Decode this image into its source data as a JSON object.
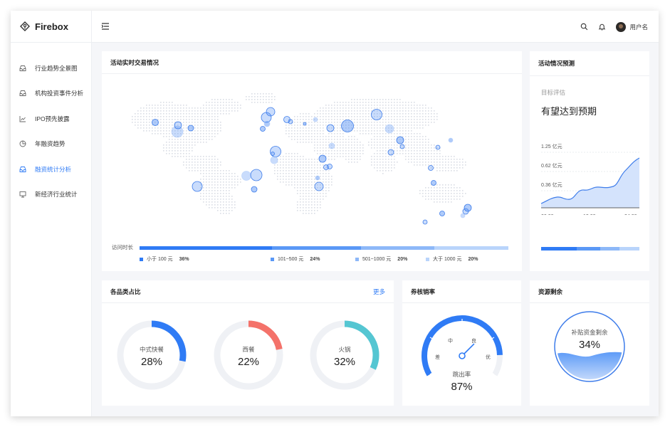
{
  "app": {
    "name": "Firebox"
  },
  "sidebar": {
    "items": [
      {
        "label": "行业趋势全景图",
        "icon": "inbox-icon",
        "active": false
      },
      {
        "label": "机构投资事件分析",
        "icon": "inbox-icon",
        "active": false
      },
      {
        "label": "IPO预先披露",
        "icon": "line-chart-icon",
        "active": false
      },
      {
        "label": "年融资趋势",
        "icon": "pie-chart-icon",
        "active": false
      },
      {
        "label": "融资统计分析",
        "icon": "inbox-icon",
        "active": true
      },
      {
        "label": "新经济行业统计",
        "icon": "monitor-icon",
        "active": false
      }
    ]
  },
  "header": {
    "username": "用户名",
    "icons": [
      "search-icon",
      "bell-icon"
    ]
  },
  "colors": {
    "accent": "#2f7bf5",
    "donut_1": "#2f7bf5",
    "donut_2": "#f4726a",
    "donut_3": "#55c6d2",
    "track": "#eff1f5"
  },
  "map_card": {
    "title": "活动实时交易情况",
    "legend_label": "访问时长",
    "legend": [
      {
        "label": "小于 100 元",
        "value": "36%",
        "share": 36,
        "color": "#2f7bf5"
      },
      {
        "label": "101~500 元",
        "value": "24%",
        "share": 24,
        "color": "#5a98f6"
      },
      {
        "label": "501~1000 元",
        "value": "20%",
        "share": 20,
        "color": "#8db8f8"
      },
      {
        "label": "大于 1000 元",
        "value": "20%",
        "share": 20,
        "color": "#b9d4fb"
      }
    ]
  },
  "forecast_card": {
    "title": "活动情况预测",
    "subtitle": "目标评估",
    "headline": "有望达到预期",
    "y_labels": [
      "1.25 亿元",
      "0.62 亿元",
      "0.36 亿元"
    ],
    "x_labels": [
      "00:00",
      "12:00",
      "24:00"
    ],
    "bar": [
      {
        "share": 36,
        "color": "#2f7bf5"
      },
      {
        "share": 24,
        "color": "#5a98f6"
      },
      {
        "share": 20,
        "color": "#8db8f8"
      },
      {
        "share": 20,
        "color": "#b9d4fb"
      }
    ]
  },
  "category_card": {
    "title": "各品类占比",
    "more": "更多",
    "donuts": [
      {
        "label": "中式快餐",
        "value": "28%",
        "fraction": 0.28,
        "color": "#2f7bf5"
      },
      {
        "label": "西餐",
        "value": "22%",
        "fraction": 0.22,
        "color": "#f4726a"
      },
      {
        "label": "火锅",
        "value": "32%",
        "fraction": 0.32,
        "color": "#55c6d2"
      }
    ]
  },
  "gauge_card": {
    "title": "券核销率",
    "labels": {
      "bad": "差",
      "mid": "中",
      "good": "良",
      "excellent": "优"
    },
    "name": "跳出率",
    "value": "87%",
    "fraction": 0.87
  },
  "resource_card": {
    "title": "资源剩余",
    "label": "补贴资金剩余",
    "value": "34%",
    "fraction": 0.34
  }
}
